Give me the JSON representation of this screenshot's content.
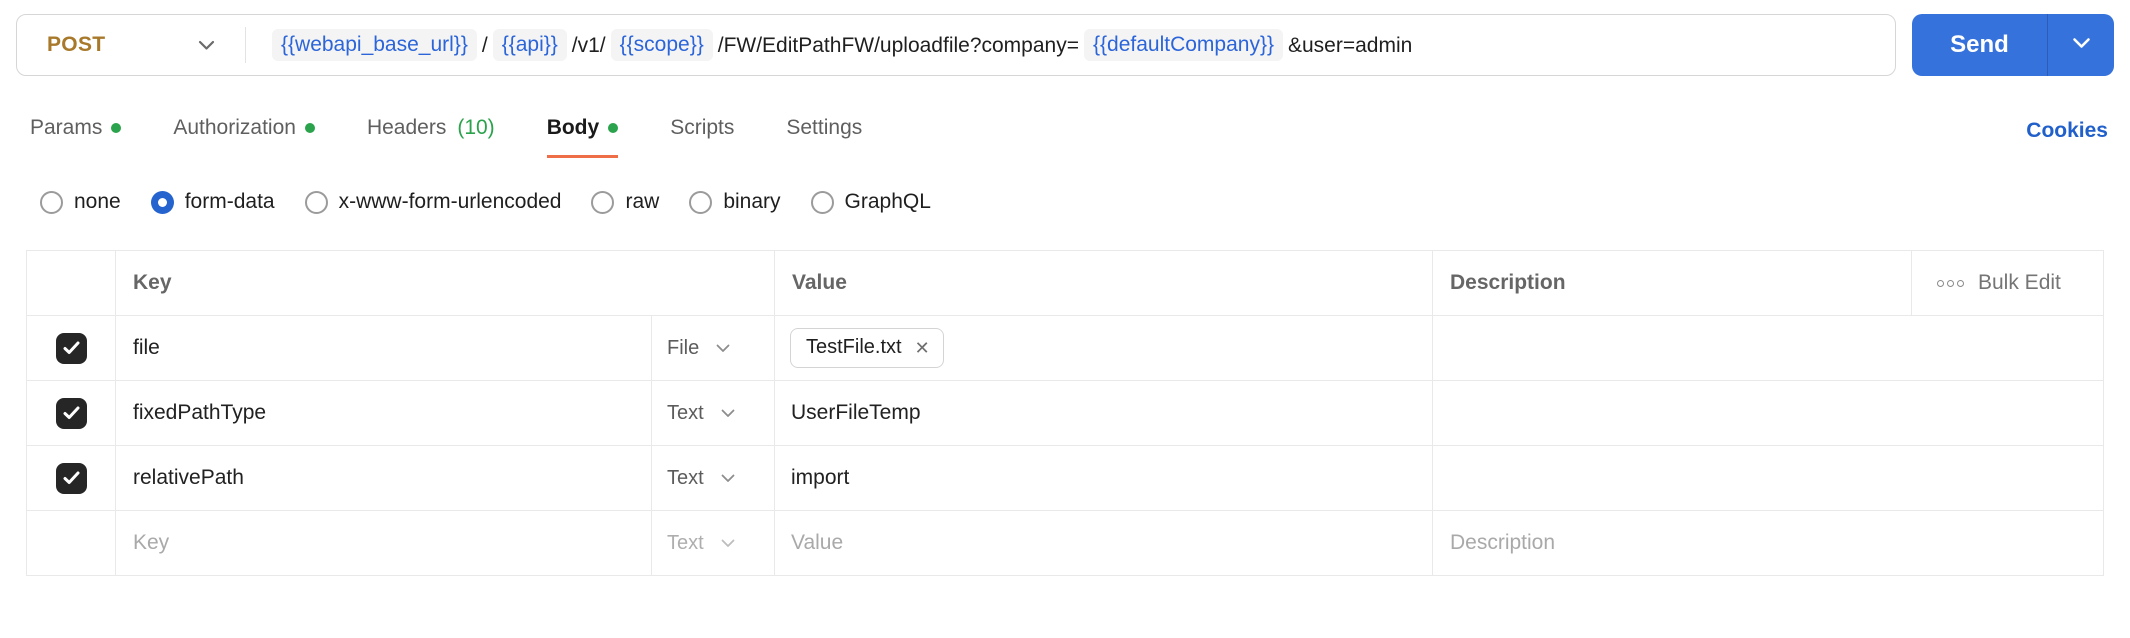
{
  "request": {
    "method": "POST",
    "url_parts": [
      {
        "kind": "variable",
        "text": "{{webapi_base_url}}"
      },
      {
        "kind": "text",
        "text": "/"
      },
      {
        "kind": "variable",
        "text": "{{api}}"
      },
      {
        "kind": "text",
        "text": "/v1/"
      },
      {
        "kind": "variable",
        "text": "{{scope}}"
      },
      {
        "kind": "text",
        "text": "/FW/EditPathFW/uploadfile?company="
      },
      {
        "kind": "variable",
        "text": "{{defaultCompany}}"
      },
      {
        "kind": "text",
        "text": "&user=admin"
      }
    ],
    "send_label": "Send"
  },
  "tabs": [
    {
      "label": "Params",
      "has_dot": true,
      "active": false
    },
    {
      "label": "Authorization",
      "has_dot": true,
      "active": false
    },
    {
      "label": "Headers",
      "count": "(10)",
      "active": false
    },
    {
      "label": "Body",
      "has_dot": true,
      "active": true
    },
    {
      "label": "Scripts",
      "active": false
    },
    {
      "label": "Settings",
      "active": false
    }
  ],
  "cookies_link": "Cookies",
  "body_types": [
    {
      "label": "none",
      "selected": false
    },
    {
      "label": "form-data",
      "selected": true
    },
    {
      "label": "x-www-form-urlencoded",
      "selected": false
    },
    {
      "label": "raw",
      "selected": false
    },
    {
      "label": "binary",
      "selected": false
    },
    {
      "label": "GraphQL",
      "selected": false
    }
  ],
  "form_table": {
    "headers": {
      "key": "Key",
      "value": "Value",
      "description": "Description",
      "bulk_edit": "Bulk Edit"
    },
    "rows": [
      {
        "checked": true,
        "key": "file",
        "type": "File",
        "value_file_chip": "TestFile.txt"
      },
      {
        "checked": true,
        "key": "fixedPathType",
        "type": "Text",
        "value": "UserFileTemp"
      },
      {
        "checked": true,
        "key": "relativePath",
        "type": "Text",
        "value": "import"
      },
      {
        "checked": false,
        "key_placeholder": "Key",
        "type": "Text",
        "value_placeholder": "Value",
        "description_placeholder": "Description"
      }
    ]
  },
  "icons": {
    "check": "✓",
    "close": "✕"
  },
  "colors": {
    "method_post": "#a8792b",
    "send_button": "#3572dc",
    "link_blue": "#2160cb",
    "variable_blue": "#2b65d9",
    "status_green": "#2ba24c",
    "active_tab_orange": "#ed6e47",
    "checkbox_dark": "#262626"
  }
}
